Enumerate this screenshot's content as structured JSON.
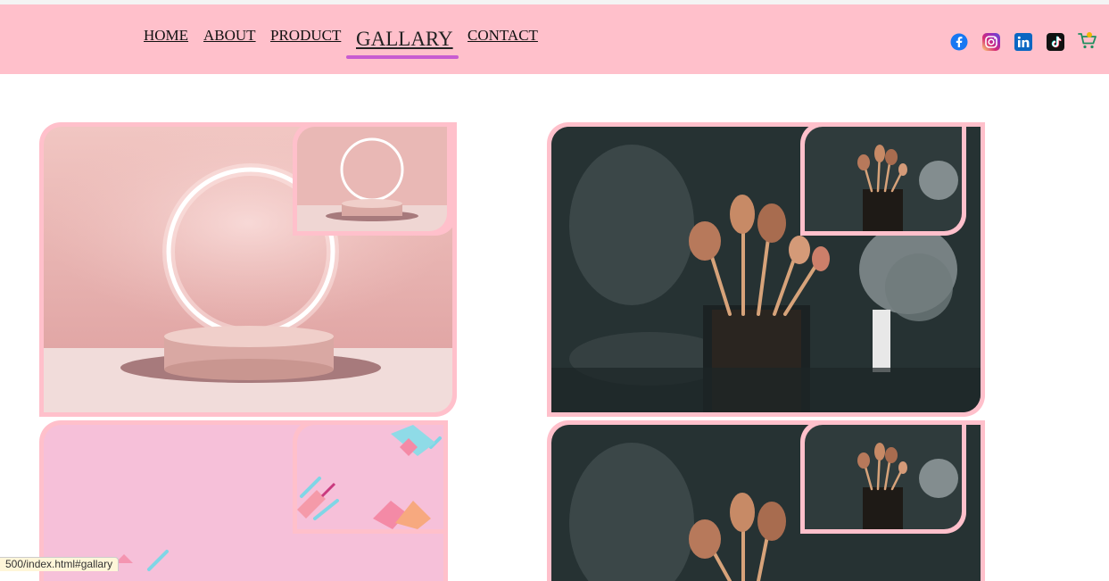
{
  "nav": {
    "links": [
      "HOME",
      "ABOUT",
      "PRODUCT",
      "GALLARY",
      "CONTACT"
    ],
    "active": "GALLARY"
  },
  "social": {
    "icons": [
      "facebook-icon",
      "instagram-icon",
      "linkedin-icon",
      "tiktok-icon",
      "shopping-cart-icon"
    ]
  },
  "gallery": {
    "items": [
      {
        "name": "ring-light-podium"
      },
      {
        "name": "makeup-brushes"
      },
      {
        "name": "pink-abstract-pattern"
      },
      {
        "name": "makeup-brushes-2"
      }
    ]
  },
  "status_bar": {
    "url": "500/index.html#gallary"
  },
  "colors": {
    "navbar": "#ffc0cb",
    "active_underline": "#c85bd1",
    "card_border": "#ffc0cb"
  }
}
